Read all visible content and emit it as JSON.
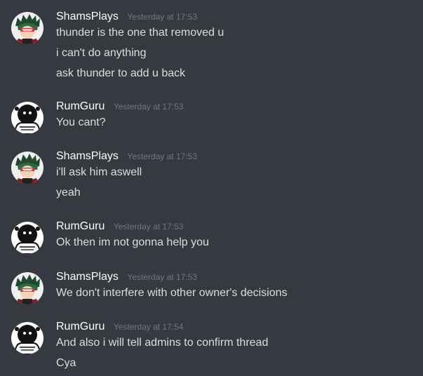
{
  "colors": {
    "background": "#36393f",
    "username": "#ffffff",
    "timestamp": "#72767d",
    "message_text": "#dcddde"
  },
  "messages": [
    {
      "author": "ShamsPlays",
      "avatar": "deku-avatar",
      "timestamp": "Yesterday at 17:53",
      "lines": [
        "thunder is the one that removed u",
        "i can't do anything",
        "ask thunder to add u back"
      ]
    },
    {
      "author": "RumGuru",
      "avatar": "astronaut-avatar",
      "timestamp": "Yesterday at 17:53",
      "lines": [
        "You cant?"
      ]
    },
    {
      "author": "ShamsPlays",
      "avatar": "deku-avatar",
      "timestamp": "Yesterday at 17:53",
      "lines": [
        "i'll ask him aswell",
        "yeah"
      ]
    },
    {
      "author": "RumGuru",
      "avatar": "astronaut-avatar",
      "timestamp": "Yesterday at 17:53",
      "lines": [
        "Ok then im not gonna help you"
      ]
    },
    {
      "author": "ShamsPlays",
      "avatar": "deku-avatar",
      "timestamp": "Yesterday at 17:53",
      "lines": [
        "We don't interfere with other owner's decisions"
      ]
    },
    {
      "author": "RumGuru",
      "avatar": "astronaut-avatar",
      "timestamp": "Yesterday at 17:54",
      "lines": [
        "And also i will tell admins to confirm thread",
        "Cya"
      ]
    }
  ]
}
